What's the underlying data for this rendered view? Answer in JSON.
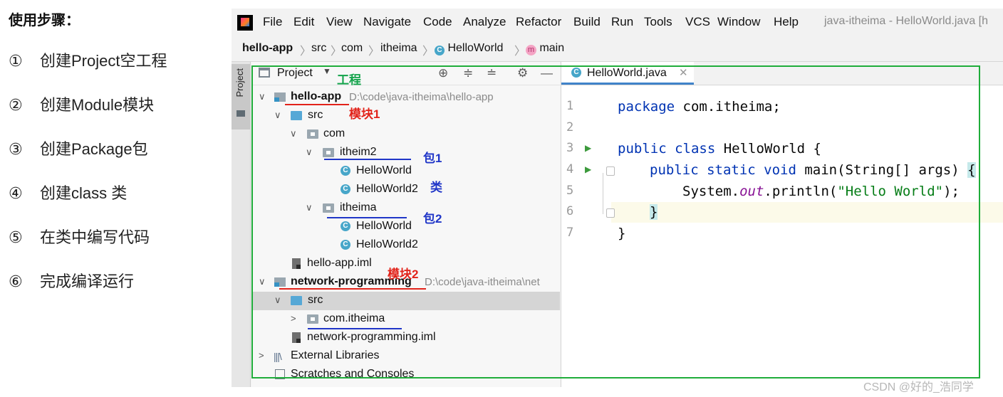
{
  "steps": {
    "title": "使用步骤：",
    "items": [
      {
        "num": "①",
        "text": "创建Project空工程"
      },
      {
        "num": "②",
        "text": "创建Module模块"
      },
      {
        "num": "③",
        "text": "创建Package包"
      },
      {
        "num": "④",
        "text": "创建class 类"
      },
      {
        "num": "⑤",
        "text": "在类中编写代码"
      },
      {
        "num": "⑥",
        "text": "完成编译运行"
      }
    ]
  },
  "menubar": {
    "items": [
      "File",
      "Edit",
      "View",
      "Navigate",
      "Code",
      "Analyze",
      "Refactor",
      "Build",
      "Run",
      "Tools",
      "VCS",
      "Window",
      "Help"
    ],
    "title": "java-itheima - HelloWorld.java [h"
  },
  "breadcrumb": [
    "hello-app",
    "src",
    "com",
    "itheima",
    "HelloWorld",
    "main"
  ],
  "project_panel": {
    "side_tab": "Project",
    "header": "Project",
    "tree": [
      {
        "label": "hello-app",
        "path": "D:\\code\\java-itheima\\hello-app",
        "kind": "module",
        "expanded": true
      },
      {
        "label": "src",
        "kind": "src",
        "expanded": true
      },
      {
        "label": "com",
        "kind": "folder",
        "expanded": true
      },
      {
        "label": "itheim2",
        "kind": "package",
        "expanded": true
      },
      {
        "label": "HelloWorld",
        "kind": "class-run"
      },
      {
        "label": "HelloWorld2",
        "kind": "class"
      },
      {
        "label": "itheima",
        "kind": "package",
        "expanded": true
      },
      {
        "label": "HelloWorld",
        "kind": "class-run"
      },
      {
        "label": "HelloWorld2",
        "kind": "class"
      },
      {
        "label": "hello-app.iml",
        "kind": "iml"
      },
      {
        "label": "network-programming",
        "path": "D:\\code\\java-itheima\\net",
        "kind": "module",
        "expanded": true
      },
      {
        "label": "src",
        "kind": "src",
        "expanded": true,
        "selected": true
      },
      {
        "label": "com.itheima",
        "kind": "package",
        "expanded": false
      },
      {
        "label": "network-programming.iml",
        "kind": "iml"
      },
      {
        "label": "External Libraries",
        "kind": "libs",
        "expanded": false
      },
      {
        "label": "Scratches and Consoles",
        "kind": "scratches"
      }
    ]
  },
  "editor": {
    "tab": "HelloWorld.java",
    "line_numbers": [
      "1",
      "2",
      "3",
      "4",
      "5",
      "6",
      "7"
    ],
    "code": {
      "l1_kw": "package",
      "l1_rest": " com.itheima;",
      "l3_kw": "public class",
      "l3_rest": " HelloWorld {",
      "l4_kw": "public static void",
      "l4_mid": " main(String[] args) ",
      "l4_brace": "{",
      "l5_a": "System.",
      "l5_out": "out",
      "l5_b": ".println(",
      "l5_str": "\"Hello World\"",
      "l5_c": ");",
      "l6": "}",
      "l7": "}"
    }
  },
  "annotations": {
    "project": "工程",
    "module1": "模块1",
    "package1": "包1",
    "class": "类",
    "package2": "包2",
    "module2": "模块2"
  },
  "watermark": "CSDN @好的_浩同学",
  "colors": {
    "frame_green": "#1fad3a",
    "annotation_red": "#e2231a",
    "annotation_blue": "#2036c8",
    "annotation_green": "#12a34a"
  }
}
